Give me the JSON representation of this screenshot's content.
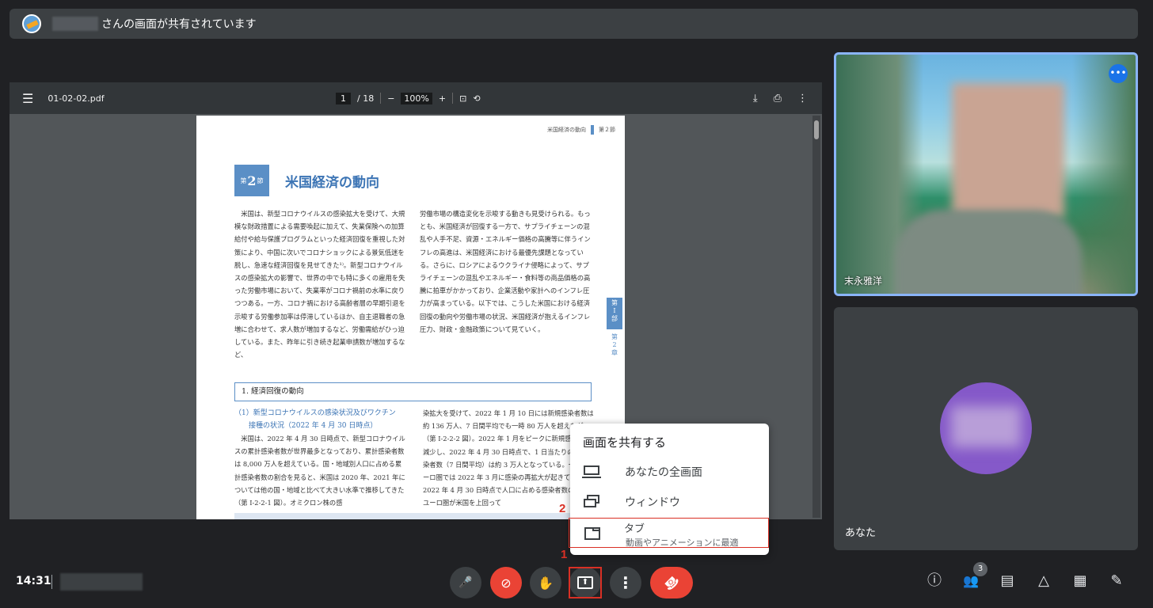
{
  "banner": {
    "text": "さんの画面が共有されています"
  },
  "pdf": {
    "menu_icon": "☰",
    "filename": "01-02-02.pdf",
    "page_current": "1",
    "page_total": "/ 18",
    "zoom_out": "−",
    "zoom": "100%",
    "zoom_in": "+",
    "fit_icon": "⊡",
    "rotate_icon": "⟲",
    "download_icon": "⤓",
    "print_icon": "⎙",
    "more_icon": "⋮",
    "page": {
      "runhead_left": "米国経済の動向",
      "runhead_right": "第２節",
      "sec_badge_pre": "第",
      "sec_badge_num": "2",
      "sec_badge_post": "節",
      "title": "米国経済の動向",
      "col1": "　米国は、新型コロナウイルスの感染拡大を受けて、大規模な財政措置による需要喚起に加えて、失業保険への加算給付や給与保護プログラムといった経済回復を重視した対策により、中国に次いでコロナショックによる景気低迷を脱し、急速な経済回復を見せてきた¹⁾。新型コロナウイルスの感染拡大の影響で、世界の中でも特に多くの雇用を失った労働市場において、失業率がコロナ禍前の水準に戻りつつある。一方、コロナ禍における高齢者層の早期引退を示唆する労働参加率は停滞しているほか、自主退職者の急増に合わせて、求人数が増加するなど、労働需給がひっ迫している。また、昨年に引き続き起業申請数が増加するなど、",
      "col2": "労働市場の構造変化を示唆する動きも見受けられる。もっとも、米国経済が回復する一方で、サプライチェーンの混乱や人手不足、資源・エネルギー価格の高騰等に伴うインフレの高進は、米国経済における最優先課題となっている。さらに、ロシアによるウクライナ侵略によって、サプライチェーンの混乱やエネルギー・食料等の商品価格の高騰に拍車がかかっており、企業活動や家計へのインフレ圧力が高まっている。以下では、こうした米国における経済回復の動向や労働市場の状況、米国経済が抱えるインフレ圧力、財政・金融政策について見ていく。",
      "side_tab": "第\nI\n部",
      "side_chap": "第\n2\n章",
      "heading": "1.  経済回復の動向",
      "sub_heading": "（1）新型コロナウイルスの感染状況及びワクチン\n　　接種の状況（2022 年 4 月 30 日時点）",
      "col3": "　米国は、2022 年 4 月 30 日時点で、新型コロナウイルスの累計感染者数が世界最多となっており、累計感染者数は 8,000 万人を超えている。国・地域別人口に占める累計感染者数の割合を見ると、米国は 2020 年、2021 年については他の国・地域と比べて大きい水準で推移してきた（第 I-2-2-1 図）。オミクロン株の感",
      "col4": "染拡大を受けて、2022 年 1 月 10 日には新規感染者数は約 136 万人、7 日間平均でも一時 80 万人を超えたが、（第 I-2-2-2 図）。2022 年 1 月をピークに新規感染者は減少し、2022 年 4 月 30 日時点で、1 日当たりの新規感染者数（7 日間平均）は約 3 万人となっている。一方、ユーロ圏では 2022 年 3 月に感染の再拡大が起きており、2022 年 4 月 30 日時点で人口に占める感染者数の割合はユーロ圏が米国を上回って"
    }
  },
  "participants": {
    "remote_name": "末永雅洋",
    "more_icon": "•••",
    "self_name": "あなた"
  },
  "share_menu": {
    "title": "画面を共有する",
    "items": [
      {
        "label": "あなたの全画面",
        "icon": "laptop-icon"
      },
      {
        "label": "ウィンドウ",
        "icon": "window-icon"
      },
      {
        "label": "タブ",
        "sub": "動画やアニメーションに最適",
        "icon": "tab-icon"
      }
    ]
  },
  "callouts": {
    "one": "1",
    "two": "2"
  },
  "bottom_bar": {
    "time": "14:31",
    "mic_icon": "🎤",
    "camera_off_icon": "⊘",
    "hand_icon": "✋",
    "present_icon": "⬆",
    "more_icon": "⋮",
    "end_icon": "☎",
    "info_icon": "ⓘ",
    "people_icon": "👥",
    "people_count": "3",
    "chat_icon": "▤",
    "activities_icon": "△",
    "layout_icon": "▦",
    "host_icon": "✎"
  },
  "colors": {
    "accent": "#1a73e8",
    "danger": "#ea4335",
    "highlight": "#d93025",
    "tile_border": "#8ab4f8",
    "pdf_blue": "#5b8fc6"
  }
}
